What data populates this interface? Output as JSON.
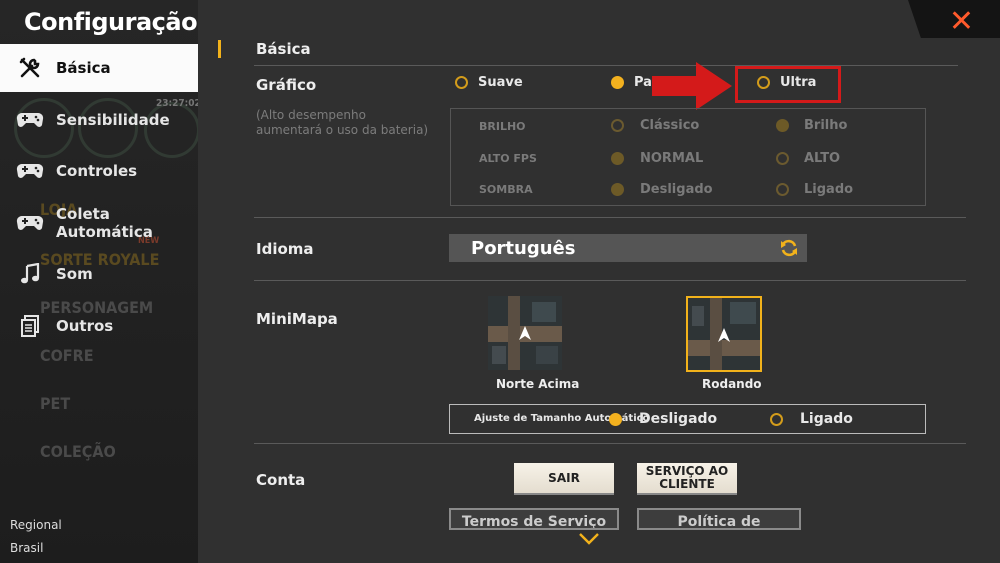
{
  "sidebar": {
    "title": "Configuração",
    "items": [
      {
        "label": "Básica",
        "icon": "tools-icon"
      },
      {
        "label": "Sensibilidade",
        "icon": "gamepad-icon"
      },
      {
        "label": "Controles",
        "icon": "gamepad-icon"
      },
      {
        "label": "Coleta Automática",
        "icon": "gamepad-icon"
      },
      {
        "label": "Som",
        "icon": "music-icon"
      },
      {
        "label": "Outros",
        "icon": "document-icon"
      }
    ],
    "ghost_labels": [
      "LOJA",
      "SORTE ROYALE",
      "PERSONAGEM",
      "COFRE",
      "PET",
      "COLEÇÃO",
      "NEW",
      "23:27:02"
    ],
    "region_label": "Regional",
    "region_value": "Brasil"
  },
  "main": {
    "section_title": "Básica",
    "grafico": {
      "label": "Gráfico",
      "note_line1": "(Alto desempenho",
      "note_line2": "aumentará o uso da bateria)",
      "options": [
        "Suave",
        "Padrão",
        "Ultra"
      ],
      "selected": "Padrão",
      "sub": {
        "brilho_label": "BRILHO",
        "brilho_options": [
          "Clássico",
          "Brilho"
        ],
        "fps_label": "ALTO FPS",
        "fps_options": [
          "NORMAL",
          "ALTO"
        ],
        "sombra_label": "SOMBRA",
        "sombra_options": [
          "Desligado",
          "Ligado"
        ]
      }
    },
    "idioma": {
      "label": "Idioma",
      "value": "Português"
    },
    "minimapa": {
      "label": "MiniMapa",
      "options": [
        "Norte Acima",
        "Rodando"
      ],
      "selected": "Rodando",
      "auto_label": "Ajuste de Tamanho Automático",
      "auto_options": [
        "Desligado",
        "Ligado"
      ],
      "auto_selected": "Desligado"
    },
    "conta": {
      "label": "Conta",
      "sair": "SAIR",
      "servico_line1": "SERVIÇO AO",
      "servico_line2": "CLIENTE",
      "termos": "Termos de Serviço",
      "politica": "Política de privacidade"
    }
  },
  "colors": {
    "accent": "#f2b21b",
    "highlight_red": "#d41a1a",
    "close_icon": "#ff5a2c"
  }
}
